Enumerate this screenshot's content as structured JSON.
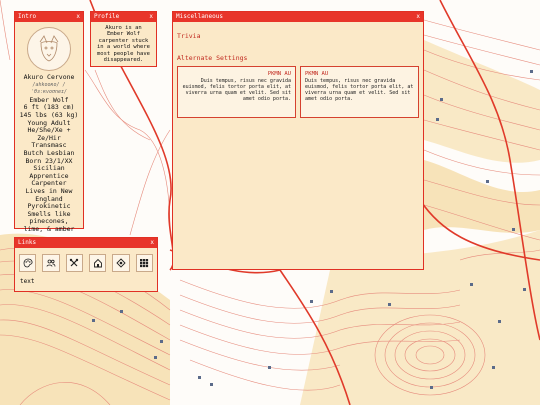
{
  "intro": {
    "title": "Intro",
    "close": "x",
    "name": "Akuro Cervone",
    "pronounce": "/ahkooʀo/ /ˈθɜːʀvoʊneɪ/",
    "lines": [
      "Ember Wolf",
      "6 ft (183 cm)",
      "145 lbs (63 kg)",
      "Young Adult",
      "He/She/Xe + Ze/Hir",
      "Transmasc",
      "Butch Lesbian",
      "Born 23/1/XX",
      "Sicilian",
      "Apprentice Carpenter",
      "Lives in New England",
      "Pyrokinetic",
      "Smells like pinecones, lime, & amber"
    ]
  },
  "profile": {
    "title": "Profile",
    "close": "x",
    "text": "Akuro is an Ember Wolf carpenter stuck in a world where most people have disappeared."
  },
  "misc": {
    "title": "Miscellaneous",
    "close": "x",
    "trivia": "Trivia",
    "alt": "Alternate Settings",
    "left_title": "PKMN AU",
    "left_text": "Duis tempus, risus nec gravida euismod, felis tortor porta elit, at viverra urna quam et velit. Sed sit amet odio porta.",
    "right_title": "PKMN AU",
    "right_text": "Duis tempus, risus nec gravida euismod, felis tortor porta elit, at viverra urna quam et velit. Sed sit amet odio porta."
  },
  "links": {
    "title": "Links",
    "close": "x",
    "icons": [
      "palette-icon",
      "people-icon",
      "tools-icon",
      "home-icon",
      "gem-icon",
      "grid-icon"
    ],
    "text": "text"
  },
  "colors": {
    "accent": "#e8352a",
    "panel": "#fbe9c8",
    "map_line": "#e37a6c",
    "map_fill": "#f7e3b9"
  }
}
